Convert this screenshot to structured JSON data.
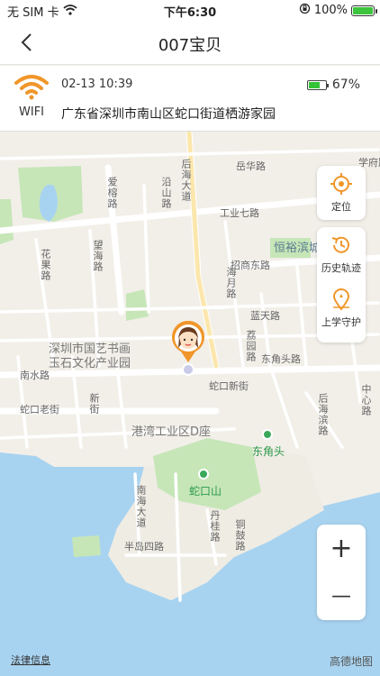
{
  "status_bar": {
    "carrier": "无 SIM 卡",
    "time": "下午6:30",
    "battery_percent": "100%",
    "battery_level": 1.0
  },
  "nav": {
    "title": "007宝贝",
    "back_icon": "chevron-left-icon"
  },
  "device": {
    "connection_label": "WIFI",
    "connection_icon": "wifi-icon",
    "timestamp": "02-13 10:39",
    "battery_percent": "67%",
    "battery_level": 0.67,
    "address": "广东省深圳市南山区蛇口街道栖游家园"
  },
  "controls": {
    "locate": "定位",
    "history": "历史轨迹",
    "school": "上学守护",
    "zoom_in": "+",
    "zoom_out": "—"
  },
  "map": {
    "roads": [
      "后海大道",
      "爱榕路",
      "工业七路",
      "招商东路",
      "海月路",
      "蓝天路",
      "蛇口新街",
      "蛇口老街",
      "南水路",
      "花果路",
      "南海大道",
      "后海滨路",
      "沿山路",
      "东角头路",
      "中心路",
      "半岛四路",
      "望海路",
      "荔园路",
      "丹桂路",
      "学府路",
      "新街",
      "岳华路",
      "铜鼓路"
    ],
    "areas": [
      "恒裕滨城",
      "深圳市国艺书画玉石文化产业园",
      "港湾工业区D座"
    ],
    "pois": [
      "东角头",
      "蛇口山"
    ]
  },
  "footer": {
    "legal": "法律信息",
    "provider": "高德地图"
  },
  "colors": {
    "accent": "#f0962a",
    "water": "#a8d3f0",
    "park": "#c6e6b8",
    "land": "#f2efe9"
  }
}
